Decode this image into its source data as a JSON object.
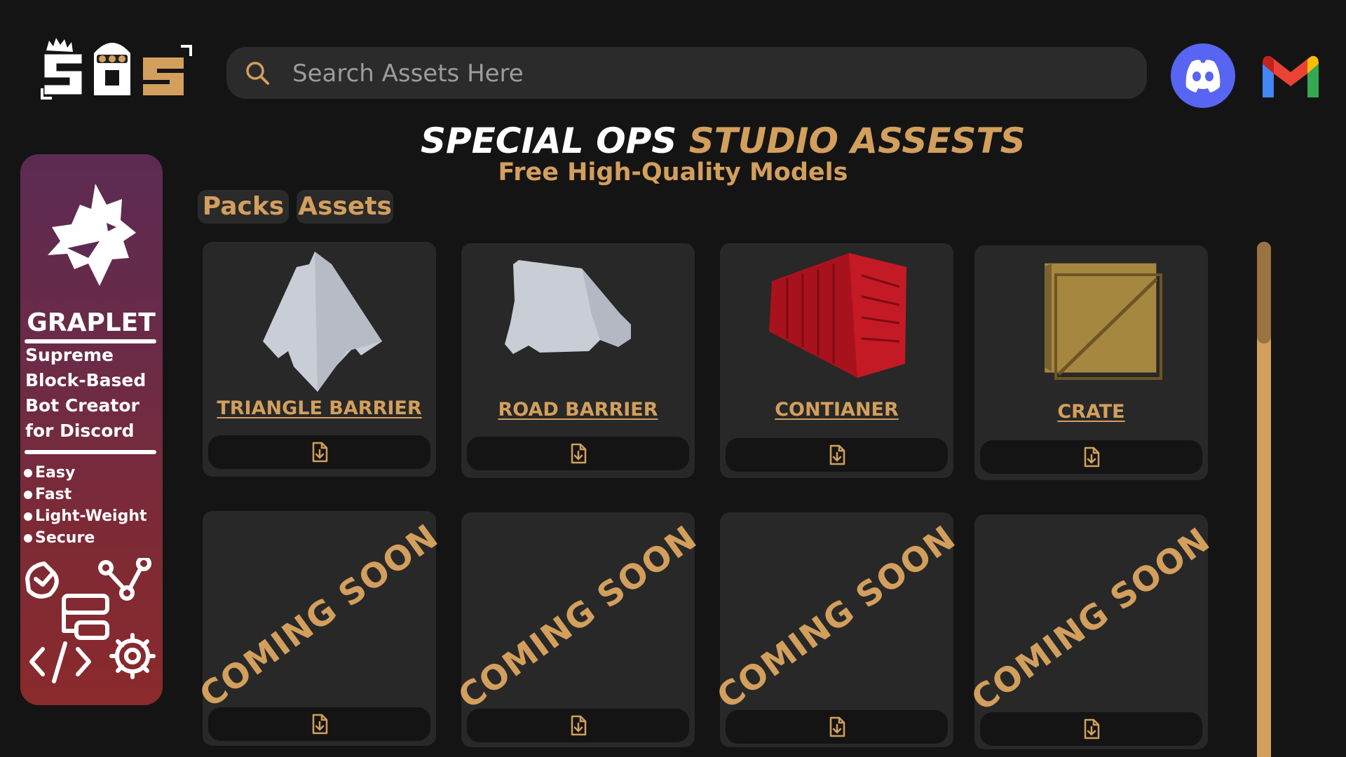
{
  "header": {
    "logo_text": "SOS",
    "search": {
      "placeholder": "Search Assets Here",
      "value": ""
    },
    "icons": [
      "search-icon",
      "discord-icon",
      "gmail-icon"
    ]
  },
  "title": {
    "part1": "SPECIAL OPS",
    "part2": "STUDIO ASSESTS",
    "subtitle": "Free High-Quality Models"
  },
  "tabs": [
    {
      "label": "Packs"
    },
    {
      "label": "Assets"
    }
  ],
  "ad": {
    "brand": "GRAPLET",
    "tagline": [
      "Supreme",
      "Block-Based",
      "Bot Creator",
      "for Discord"
    ],
    "features": [
      "Easy",
      "Fast",
      "Light-Weight",
      "Secure"
    ]
  },
  "assets": [
    {
      "name": "TRIANGLE BARRIER",
      "image": "triangle-barrier",
      "color": "#c9cdd6"
    },
    {
      "name": "ROAD BARRIER",
      "image": "road-barrier",
      "color": "#c9cdd6"
    },
    {
      "name": "CONTIANER",
      "image": "shipping-container",
      "color": "#a8121c"
    },
    {
      "name": "CRATE",
      "image": "wooden-crate",
      "color": "#a58740"
    }
  ],
  "placeholders": [
    {
      "label": "COMING SOON"
    },
    {
      "label": "COMING SOON"
    },
    {
      "label": "COMING SOON"
    },
    {
      "label": "COMING SOON"
    }
  ],
  "colors": {
    "background": "#141414",
    "card": "#282828",
    "accent": "#d39f5d",
    "ad_top": "#5c2b53",
    "ad_bottom": "#8a2a2c"
  }
}
